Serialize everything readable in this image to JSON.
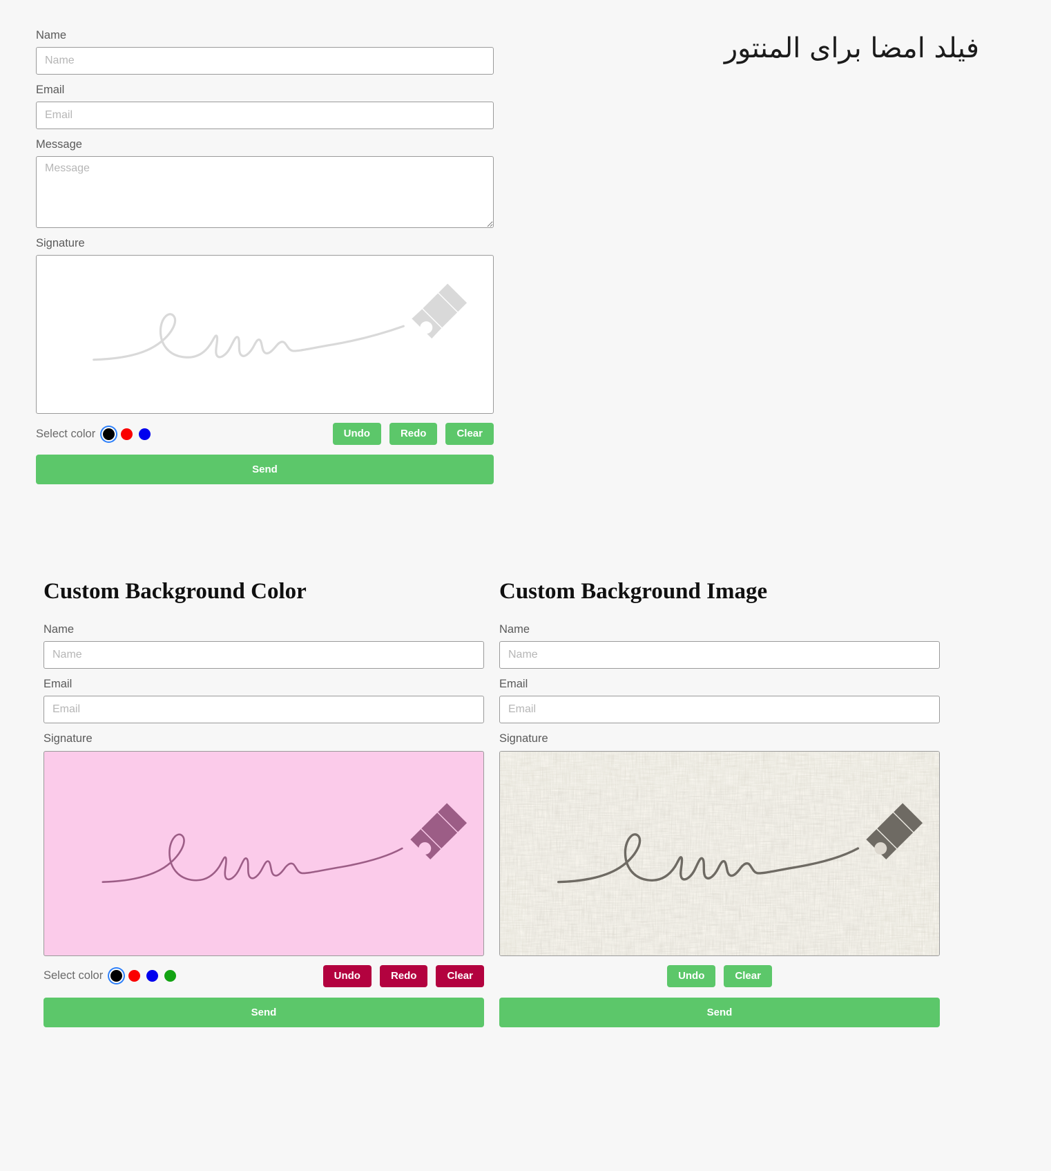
{
  "page": {
    "rtl_heading": "فیلد امضا برای المنتور",
    "background_color": "#f7f7f7"
  },
  "top_form": {
    "name": {
      "label": "Name",
      "value": "",
      "placeholder": "Name"
    },
    "email": {
      "label": "Email",
      "value": "",
      "placeholder": "Email"
    },
    "message": {
      "label": "Message",
      "value": "",
      "placeholder": "Message"
    },
    "signature": {
      "label": "Signature",
      "canvas_background": "#ffffff",
      "stroke_color": "#d9d9d9"
    },
    "color_picker": {
      "label": "Select color",
      "selected_index": 0,
      "swatches": [
        {
          "name": "black",
          "hex": "#000000"
        },
        {
          "name": "red",
          "hex": "#fa0000"
        },
        {
          "name": "blue",
          "hex": "#0000ee"
        }
      ]
    },
    "actions": [
      {
        "name": "undo",
        "label": "Undo",
        "style": "green"
      },
      {
        "name": "redo",
        "label": "Redo",
        "style": "green"
      },
      {
        "name": "clear",
        "label": "Clear",
        "style": "green"
      }
    ],
    "submit": {
      "label": "Send",
      "color": "#5cc76a"
    }
  },
  "section_bg_color": {
    "title": "Custom Background Color",
    "name": {
      "label": "Name",
      "value": "",
      "placeholder": "Name"
    },
    "email": {
      "label": "Email",
      "value": "",
      "placeholder": "Email"
    },
    "signature": {
      "label": "Signature",
      "canvas_background": "#fbcbea",
      "stroke_color": "#9c5d86"
    },
    "color_picker": {
      "label": "Select color",
      "selected_index": 0,
      "swatches": [
        {
          "name": "black",
          "hex": "#000000"
        },
        {
          "name": "red",
          "hex": "#fa0000"
        },
        {
          "name": "blue",
          "hex": "#0000ee"
        },
        {
          "name": "green",
          "hex": "#13a313"
        }
      ]
    },
    "actions": [
      {
        "name": "undo",
        "label": "Undo",
        "style": "crimson"
      },
      {
        "name": "redo",
        "label": "Redo",
        "style": "crimson"
      },
      {
        "name": "clear",
        "label": "Clear",
        "style": "crimson"
      }
    ],
    "submit": {
      "label": "Send",
      "color": "#5cc76a"
    }
  },
  "section_bg_image": {
    "title": "Custom Background Image",
    "name": {
      "label": "Name",
      "value": "",
      "placeholder": "Name"
    },
    "email": {
      "label": "Email",
      "value": "",
      "placeholder": "Email"
    },
    "signature": {
      "label": "Signature",
      "canvas_background": "linen-texture",
      "stroke_color": "#6e6a63"
    },
    "actions": [
      {
        "name": "undo",
        "label": "Undo",
        "style": "green"
      },
      {
        "name": "clear",
        "label": "Clear",
        "style": "green"
      }
    ],
    "submit": {
      "label": "Send",
      "color": "#5cc76a"
    }
  }
}
